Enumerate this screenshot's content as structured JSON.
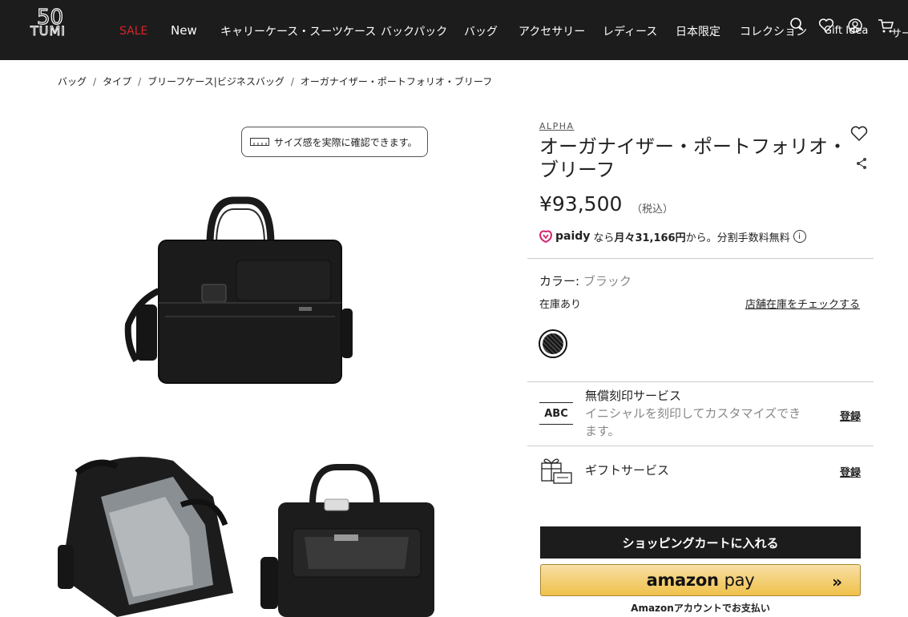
{
  "header": {
    "logo": {
      "numeral": "50",
      "wordmark": "TUMI"
    },
    "nav": [
      "SALE",
      "New",
      "キャリーケース・スーツケース",
      "バックパック",
      "バッグ",
      "アクセサリー",
      "レディース",
      "日本限定",
      "コレクション"
    ],
    "gift_idea": "Gift Idea",
    "service": "サー",
    "icons": [
      "search-icon",
      "wishlist-icon",
      "account-icon",
      "cart-icon"
    ]
  },
  "breadcrumb": [
    "バッグ",
    "タイプ",
    "ブリーフケース|ビジネスバッグ",
    "オーガナイザー・ポートフォリオ・ブリーフ"
  ],
  "gallery": {
    "size_check": "サイズ感を実際に確認できます。"
  },
  "product": {
    "brand": "ALPHA",
    "title": "オーガナイザー・ポートフォリオ・ブリーフ",
    "price": "¥93,500",
    "tax": "（税込）",
    "paidy": {
      "logo": "paidy",
      "prefix": "なら",
      "monthly": "月々31,166円",
      "suffix": "から。分割手数料無料",
      "info": "i"
    },
    "color_label": "カラー:",
    "color_value": "ブラック",
    "stock": "在庫あり",
    "store_check": "店舗在庫をチェックする"
  },
  "services": {
    "monogram": {
      "icon_text": "ABC",
      "title": "無償刻印サービス",
      "desc": "イニシャルを刻印してカスタマイズできます。",
      "link": "登録"
    },
    "gift": {
      "title": "ギフトサービス",
      "link": "登録"
    }
  },
  "actions": {
    "add_to_cart": "ショッピングカートに入れる",
    "amazon_brand": "amazon",
    "amazon_pay": "pay",
    "amazon_arrow": "»",
    "amazon_caption": "Amazonアカウントでお支払い"
  },
  "colors": {
    "header_bg": "#1c1c1c",
    "sale": "#d8232a",
    "amazon_yellow": "#f0c14b"
  }
}
